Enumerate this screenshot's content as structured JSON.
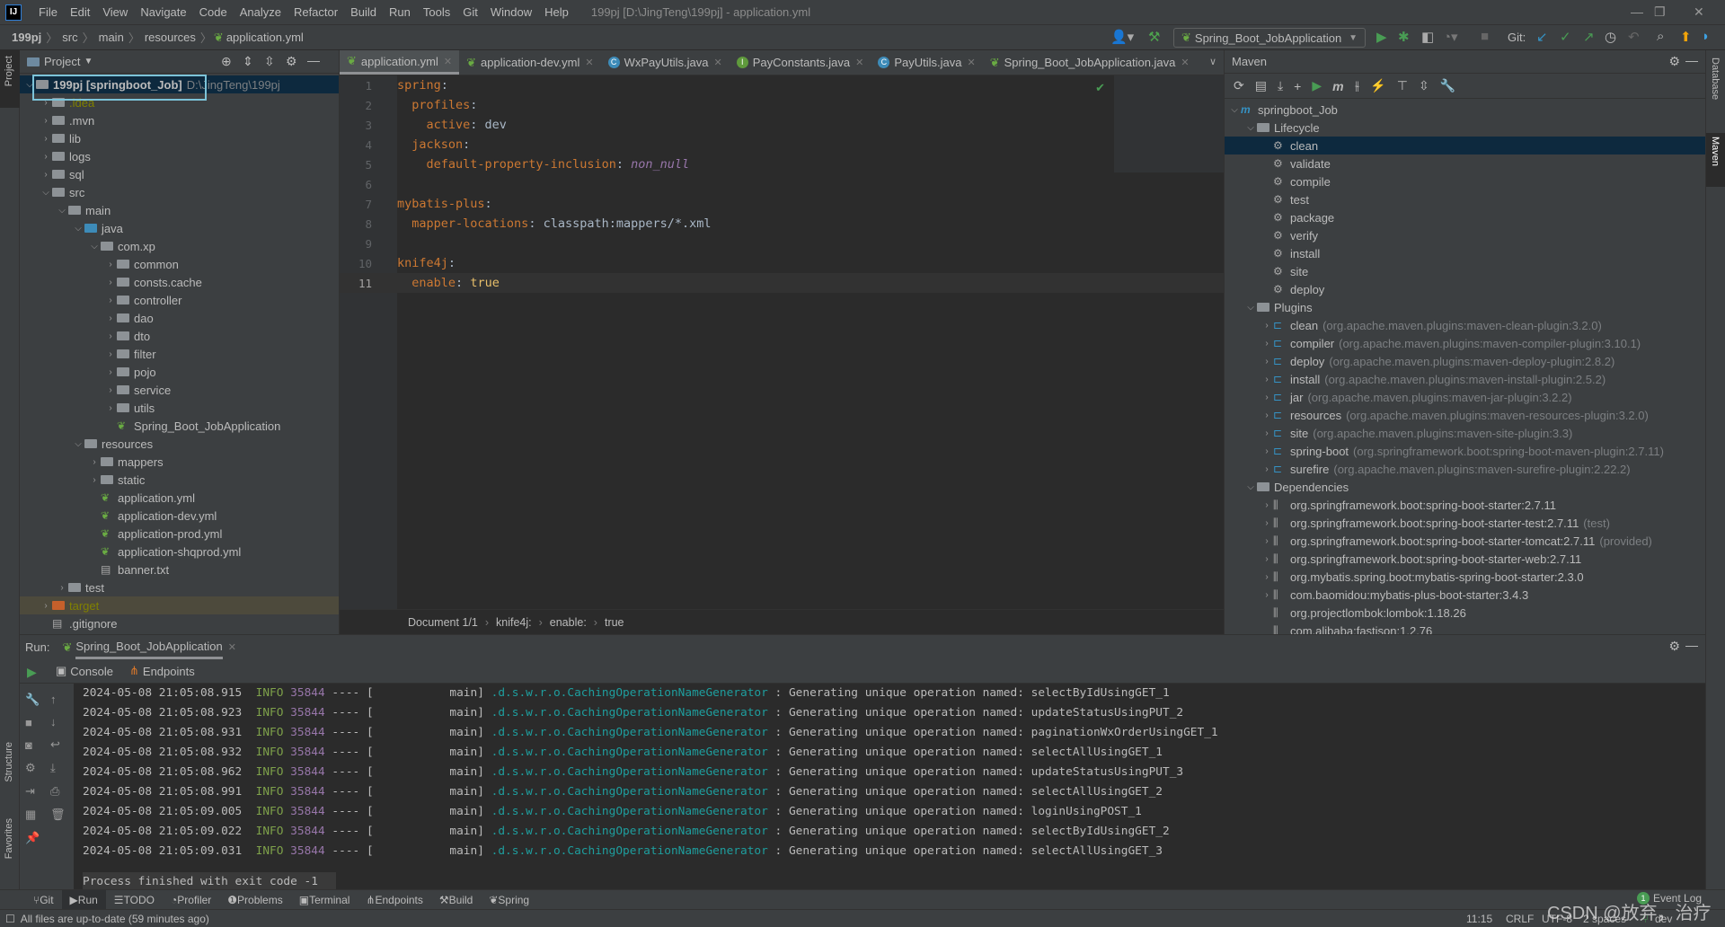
{
  "menubar": {
    "items": [
      "File",
      "Edit",
      "View",
      "Navigate",
      "Code",
      "Analyze",
      "Refactor",
      "Build",
      "Run",
      "Tools",
      "Git",
      "Window",
      "Help"
    ],
    "title": "199pj [D:\\JingTeng\\199pj] - application.yml"
  },
  "breadcrumb": [
    "199pj",
    "src",
    "main",
    "resources",
    "application.yml"
  ],
  "toolbar": {
    "run_config": "Spring_Boot_JobApplication",
    "git_label": "Git:"
  },
  "project": {
    "title": "Project",
    "tree": [
      {
        "d": 0,
        "open": true,
        "icon": "module",
        "label": "199pj [springboot_Job]",
        "hint": "D:\\JingTeng\\199pj",
        "sel": true
      },
      {
        "d": 1,
        "c": true,
        "icon": "folder",
        "label": ".idea",
        "color": "#808000"
      },
      {
        "d": 1,
        "c": true,
        "icon": "folder",
        "label": ".mvn"
      },
      {
        "d": 1,
        "c": true,
        "icon": "folder",
        "label": "lib"
      },
      {
        "d": 1,
        "c": true,
        "icon": "folder",
        "label": "logs"
      },
      {
        "d": 1,
        "c": true,
        "icon": "folder",
        "label": "sql"
      },
      {
        "d": 1,
        "open": true,
        "icon": "folder",
        "label": "src"
      },
      {
        "d": 2,
        "open": true,
        "icon": "folder",
        "label": "main"
      },
      {
        "d": 3,
        "open": true,
        "icon": "blue",
        "label": "java"
      },
      {
        "d": 4,
        "open": true,
        "icon": "folder",
        "label": "com.xp"
      },
      {
        "d": 5,
        "c": true,
        "icon": "folder",
        "label": "common"
      },
      {
        "d": 5,
        "c": true,
        "icon": "folder",
        "label": "consts.cache"
      },
      {
        "d": 5,
        "c": true,
        "icon": "folder",
        "label": "controller"
      },
      {
        "d": 5,
        "c": true,
        "icon": "folder",
        "label": "dao"
      },
      {
        "d": 5,
        "c": true,
        "icon": "folder",
        "label": "dto"
      },
      {
        "d": 5,
        "c": true,
        "icon": "folder",
        "label": "filter"
      },
      {
        "d": 5,
        "c": true,
        "icon": "folder",
        "label": "pojo"
      },
      {
        "d": 5,
        "c": true,
        "icon": "folder",
        "label": "service"
      },
      {
        "d": 5,
        "c": true,
        "icon": "folder",
        "label": "utils"
      },
      {
        "d": 5,
        "icon": "spring",
        "label": "Spring_Boot_JobApplication"
      },
      {
        "d": 3,
        "open": true,
        "icon": "folder",
        "label": "resources"
      },
      {
        "d": 4,
        "c": true,
        "icon": "folder",
        "label": "mappers"
      },
      {
        "d": 4,
        "c": true,
        "icon": "folder",
        "label": "static"
      },
      {
        "d": 4,
        "icon": "spring",
        "label": "application.yml"
      },
      {
        "d": 4,
        "icon": "spring",
        "label": "application-dev.yml"
      },
      {
        "d": 4,
        "icon": "spring",
        "label": "application-prod.yml"
      },
      {
        "d": 4,
        "icon": "spring",
        "label": "application-shqprod.yml"
      },
      {
        "d": 4,
        "icon": "txt",
        "label": "banner.txt"
      },
      {
        "d": 2,
        "c": true,
        "icon": "folder",
        "label": "test"
      },
      {
        "d": 1,
        "c": true,
        "icon": "orange",
        "label": "target",
        "color": "#808000",
        "hl": true
      },
      {
        "d": 1,
        "icon": "txt",
        "label": ".gitignore"
      }
    ]
  },
  "editor": {
    "tabs": [
      {
        "label": "application.yml",
        "icon": "spring",
        "active": true
      },
      {
        "label": "application-dev.yml",
        "icon": "spring"
      },
      {
        "label": "WxPayUtils.java",
        "icon": "C"
      },
      {
        "label": "PayConstants.java",
        "icon": "I"
      },
      {
        "label": "PayUtils.java",
        "icon": "C"
      },
      {
        "label": "Spring_Boot_JobApplication.java",
        "icon": "spring"
      }
    ],
    "lines": [
      [
        [
          "k",
          "spring"
        ],
        [
          "v",
          ":"
        ]
      ],
      [
        [
          "v",
          "  "
        ],
        [
          "k",
          "profiles"
        ],
        [
          "v",
          ":"
        ]
      ],
      [
        [
          "v",
          "    "
        ],
        [
          "k",
          "active"
        ],
        [
          "v",
          ": dev"
        ]
      ],
      [
        [
          "v",
          "  "
        ],
        [
          "k",
          "jackson"
        ],
        [
          "v",
          ":"
        ]
      ],
      [
        [
          "v",
          "    "
        ],
        [
          "k",
          "default-property-inclusion"
        ],
        [
          "v",
          ": "
        ],
        [
          "it",
          "non_null"
        ]
      ],
      [],
      [
        [
          "k",
          "mybatis-plus"
        ],
        [
          "v",
          ":"
        ]
      ],
      [
        [
          "v",
          "  "
        ],
        [
          "k",
          "mapper-locations"
        ],
        [
          "v",
          ": classpath:mappers/*.xml"
        ]
      ],
      [],
      [
        [
          "k",
          "knife4j"
        ],
        [
          "v",
          ":"
        ]
      ],
      [
        [
          "v",
          "  "
        ],
        [
          "k",
          "enable"
        ],
        [
          "v",
          ": "
        ],
        [
          "t",
          "true"
        ]
      ]
    ],
    "current_line": 11,
    "breadcrumb": [
      "Document 1/1",
      "knife4j:",
      "enable:",
      "true"
    ]
  },
  "maven": {
    "title": "Maven",
    "tree": [
      {
        "d": 0,
        "open": true,
        "icon": "m",
        "label": "springboot_Job"
      },
      {
        "d": 1,
        "open": true,
        "icon": "mf",
        "label": "Lifecycle"
      },
      {
        "d": 2,
        "icon": "gear",
        "label": "clean",
        "sel": true
      },
      {
        "d": 2,
        "icon": "gear",
        "label": "validate"
      },
      {
        "d": 2,
        "icon": "gear",
        "label": "compile"
      },
      {
        "d": 2,
        "icon": "gear",
        "label": "test"
      },
      {
        "d": 2,
        "icon": "gear",
        "label": "package"
      },
      {
        "d": 2,
        "icon": "gear",
        "label": "verify"
      },
      {
        "d": 2,
        "icon": "gear",
        "label": "install"
      },
      {
        "d": 2,
        "icon": "gear",
        "label": "site"
      },
      {
        "d": 2,
        "icon": "gear",
        "label": "deploy"
      },
      {
        "d": 1,
        "open": true,
        "icon": "mf",
        "label": "Plugins"
      },
      {
        "d": 2,
        "c": true,
        "icon": "plug",
        "label": "clean",
        "hint": "(org.apache.maven.plugins:maven-clean-plugin:3.2.0)"
      },
      {
        "d": 2,
        "c": true,
        "icon": "plug",
        "label": "compiler",
        "hint": "(org.apache.maven.plugins:maven-compiler-plugin:3.10.1)"
      },
      {
        "d": 2,
        "c": true,
        "icon": "plug",
        "label": "deploy",
        "hint": "(org.apache.maven.plugins:maven-deploy-plugin:2.8.2)"
      },
      {
        "d": 2,
        "c": true,
        "icon": "plug",
        "label": "install",
        "hint": "(org.apache.maven.plugins:maven-install-plugin:2.5.2)"
      },
      {
        "d": 2,
        "c": true,
        "icon": "plug",
        "label": "jar",
        "hint": "(org.apache.maven.plugins:maven-jar-plugin:3.2.2)"
      },
      {
        "d": 2,
        "c": true,
        "icon": "plug",
        "label": "resources",
        "hint": "(org.apache.maven.plugins:maven-resources-plugin:3.2.0)"
      },
      {
        "d": 2,
        "c": true,
        "icon": "plug",
        "label": "site",
        "hint": "(org.apache.maven.plugins:maven-site-plugin:3.3)"
      },
      {
        "d": 2,
        "c": true,
        "icon": "plug",
        "label": "spring-boot",
        "hint": "(org.springframework.boot:spring-boot-maven-plugin:2.7.11)"
      },
      {
        "d": 2,
        "c": true,
        "icon": "plug",
        "label": "surefire",
        "hint": "(org.apache.maven.plugins:maven-surefire-plugin:2.22.2)"
      },
      {
        "d": 1,
        "open": true,
        "icon": "df",
        "label": "Dependencies"
      },
      {
        "d": 2,
        "c": true,
        "icon": "lib",
        "label": "org.springframework.boot:spring-boot-starter:2.7.11"
      },
      {
        "d": 2,
        "c": true,
        "icon": "lib",
        "label": "org.springframework.boot:spring-boot-starter-test:2.7.11",
        "hint": "(test)"
      },
      {
        "d": 2,
        "c": true,
        "icon": "lib",
        "label": "org.springframework.boot:spring-boot-starter-tomcat:2.7.11",
        "hint": "(provided)"
      },
      {
        "d": 2,
        "c": true,
        "icon": "lib",
        "label": "org.springframework.boot:spring-boot-starter-web:2.7.11"
      },
      {
        "d": 2,
        "c": true,
        "icon": "lib",
        "label": "org.mybatis.spring.boot:mybatis-spring-boot-starter:2.3.0"
      },
      {
        "d": 2,
        "c": true,
        "icon": "lib",
        "label": "com.baomidou:mybatis-plus-boot-starter:3.4.3"
      },
      {
        "d": 2,
        "icon": "lib",
        "label": "org.projectlombok:lombok:1.18.26"
      },
      {
        "d": 2,
        "icon": "lib",
        "label": "com.alibaba:fastjson:1.2.76"
      }
    ]
  },
  "run": {
    "label": "Run:",
    "config": "Spring_Boot_JobApplication",
    "tabs": [
      "Console",
      "Endpoints"
    ],
    "logs": [
      {
        "ts": "2024-05-08 21:05:08.915",
        "op": "selectByIdUsingGET_1"
      },
      {
        "ts": "2024-05-08 21:05:08.923",
        "op": "updateStatusUsingPUT_2"
      },
      {
        "ts": "2024-05-08 21:05:08.931",
        "op": "paginationWxOrderUsingGET_1"
      },
      {
        "ts": "2024-05-08 21:05:08.932",
        "op": "selectAllUsingGET_1"
      },
      {
        "ts": "2024-05-08 21:05:08.962",
        "op": "updateStatusUsingPUT_3"
      },
      {
        "ts": "2024-05-08 21:05:08.991",
        "op": "selectAllUsingGET_2"
      },
      {
        "ts": "2024-05-08 21:05:09.005",
        "op": "loginUsingPOST_1"
      },
      {
        "ts": "2024-05-08 21:05:09.022",
        "op": "selectByIdUsingGET_2"
      },
      {
        "ts": "2024-05-08 21:05:09.031",
        "op": "selectAllUsingGET_3"
      }
    ],
    "level": "INFO",
    "pid": "35844",
    "thread": "---- [           main]",
    "logger": ".d.s.w.r.o.CachingOperationNameGenerator",
    "msg": ": Generating unique operation named: ",
    "exit": "Process finished with exit code -1"
  },
  "side": {
    "left_top": "Project",
    "left_structure": "Structure",
    "left_favorites": "Favorites",
    "right_database": "Database",
    "right_maven": "Maven"
  },
  "bottom_tabs": [
    "Git",
    "Run",
    "TODO",
    "Profiler",
    "Problems",
    "Terminal",
    "Endpoints",
    "Build",
    "Spring"
  ],
  "bottom_active": "Run",
  "status": {
    "message": "All files are up-to-date (59 minutes ago)",
    "position": "11:15",
    "line_sep": "CRLF",
    "encoding": "UTF-8",
    "indent": "2 spaces",
    "branch": "dev",
    "event_log": "Event Log",
    "event_count": "1"
  },
  "watermark": "CSDN @放弃，治疗"
}
